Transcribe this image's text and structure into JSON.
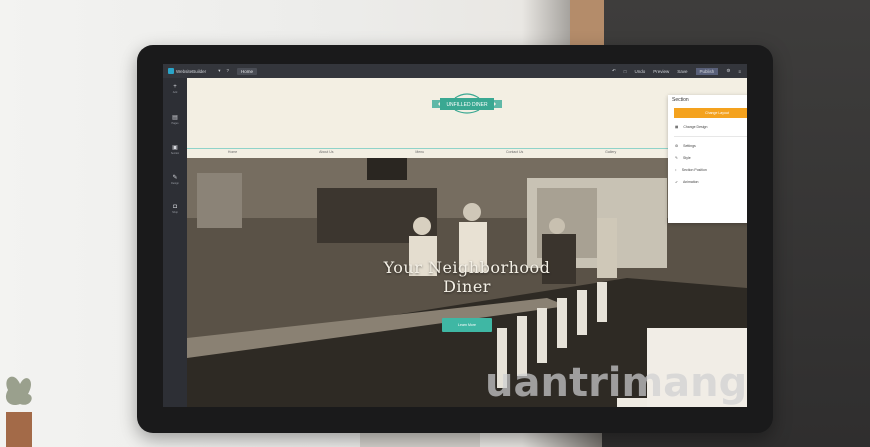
{
  "topbar": {
    "app_name": "WebsiteBuilder",
    "page_select": "Home",
    "items": [
      "Undo",
      "Preview",
      "Save",
      "Publish"
    ]
  },
  "sidebar": {
    "tools": [
      {
        "icon": "plus-icon",
        "label": "Add"
      },
      {
        "icon": "page-icon",
        "label": "Pages"
      },
      {
        "icon": "section-icon",
        "label": "Section"
      },
      {
        "icon": "pen-icon",
        "label": "Design"
      },
      {
        "icon": "cup-icon",
        "label": "Shop"
      }
    ]
  },
  "site": {
    "badge_text": "UNFILLED DINER",
    "nav": [
      "Home",
      "About Us",
      "Menu",
      "Contact Us",
      "Gallery",
      "More"
    ],
    "hero_title": "Your Neighborhood Diner",
    "hero_button": "Learn More"
  },
  "panel": {
    "title": "Section",
    "change_button": "Change Layout",
    "items": [
      "Change Design",
      "Settings",
      "Style",
      "Section Position",
      "Animation"
    ]
  },
  "watermark": "uantrimang",
  "colors": {
    "accent": "#3fb7a4",
    "orange": "#f4a21e",
    "topbar": "#34363c"
  }
}
